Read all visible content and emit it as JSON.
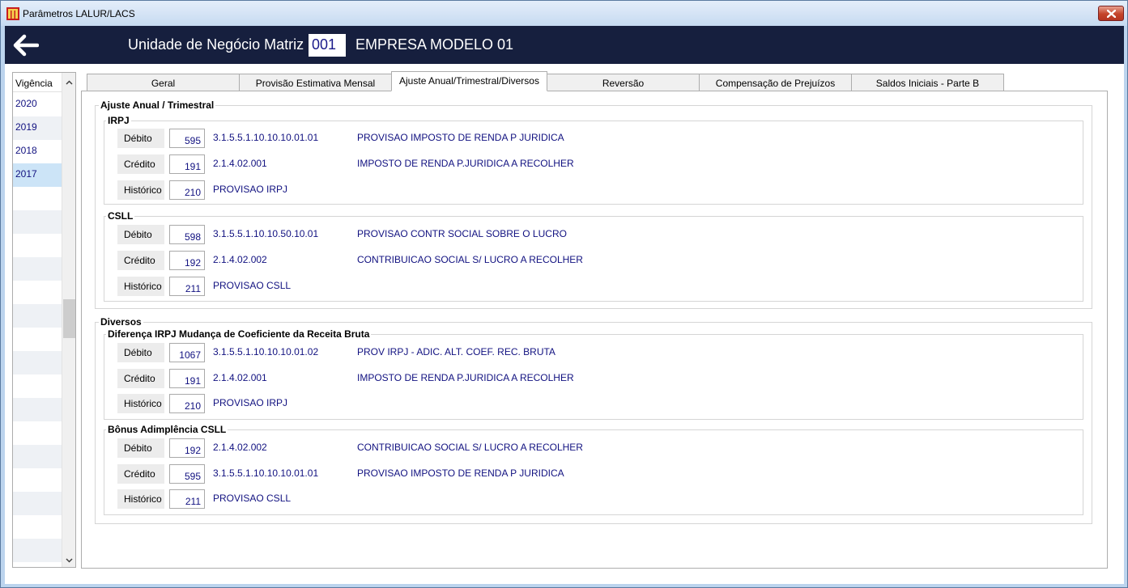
{
  "window": {
    "title": "Parâmetros LALUR/LACS"
  },
  "header": {
    "unit_label": "Unidade de Negócio Matriz",
    "unit_code": "001",
    "company_name": "EMPRESA MODELO 01"
  },
  "vigencia": {
    "header": "Vigência",
    "items": [
      "2020",
      "2019",
      "2018",
      "2017"
    ],
    "selected": "2017"
  },
  "tabs": [
    "Geral",
    "Provisão Estimativa Mensal",
    "Ajuste Anual/Trimestral/Diversos",
    "Reversão",
    "Compensação de Prejuízos",
    "Saldos Iniciais - Parte B"
  ],
  "active_tab": "Ajuste Anual/Trimestral/Diversos",
  "ajuste": {
    "title": "Ajuste Anual / Trimestral",
    "irpj": {
      "title": "IRPJ",
      "debito": {
        "label": "Débito",
        "code": "595",
        "account": "3.1.5.5.1.10.10.10.01.01",
        "description": "PROVISAO IMPOSTO DE RENDA P JURIDICA"
      },
      "credito": {
        "label": "Crédito",
        "code": "191",
        "account": "2.1.4.02.001",
        "description": "IMPOSTO DE RENDA P.JURIDICA A RECOLHER"
      },
      "historico": {
        "label": "Histórico",
        "code": "210",
        "account": "PROVISAO IRPJ"
      }
    },
    "csll": {
      "title": "CSLL",
      "debito": {
        "label": "Débito",
        "code": "598",
        "account": "3.1.5.5.1.10.10.50.10.01",
        "description": "PROVISAO CONTR SOCIAL SOBRE O LUCRO"
      },
      "credito": {
        "label": "Crédito",
        "code": "192",
        "account": "2.1.4.02.002",
        "description": "CONTRIBUICAO SOCIAL S/ LUCRO A RECOLHER"
      },
      "historico": {
        "label": "Histórico",
        "code": "211",
        "account": "PROVISAO CSLL"
      }
    }
  },
  "diversos": {
    "title": "Diversos",
    "diferenca": {
      "title": "Diferença IRPJ Mudança de Coeficiente da Receita Bruta",
      "debito": {
        "label": "Débito",
        "code": "1067",
        "account": "3.1.5.5.1.10.10.10.01.02",
        "description": "PROV IRPJ - ADIC. ALT. COEF. REC. BRUTA"
      },
      "credito": {
        "label": "Crédito",
        "code": "191",
        "account": "2.1.4.02.001",
        "description": "IMPOSTO DE RENDA P.JURIDICA A RECOLHER"
      },
      "historico": {
        "label": "Histórico",
        "code": "210",
        "account": "PROVISAO IRPJ"
      }
    },
    "bonus": {
      "title": "Bônus Adimplência CSLL",
      "debito": {
        "label": "Débito",
        "code": "192",
        "account": "2.1.4.02.002",
        "description": "CONTRIBUICAO SOCIAL S/ LUCRO A RECOLHER"
      },
      "credito": {
        "label": "Crédito",
        "code": "595",
        "account": "3.1.5.5.1.10.10.10.01.01",
        "description": "PROVISAO IMPOSTO DE RENDA P JURIDICA"
      },
      "historico": {
        "label": "Histórico",
        "code": "211",
        "account": "PROVISAO CSLL"
      }
    }
  },
  "colors": {
    "header_bg": "#161f3e",
    "value_text": "#111180",
    "selected_row": "#cce4f7"
  },
  "icons": {
    "app": "app-icon",
    "close": "close-icon",
    "back": "back-arrow-icon",
    "scroll_up": "chevron-up-icon",
    "scroll_down": "chevron-down-icon"
  }
}
